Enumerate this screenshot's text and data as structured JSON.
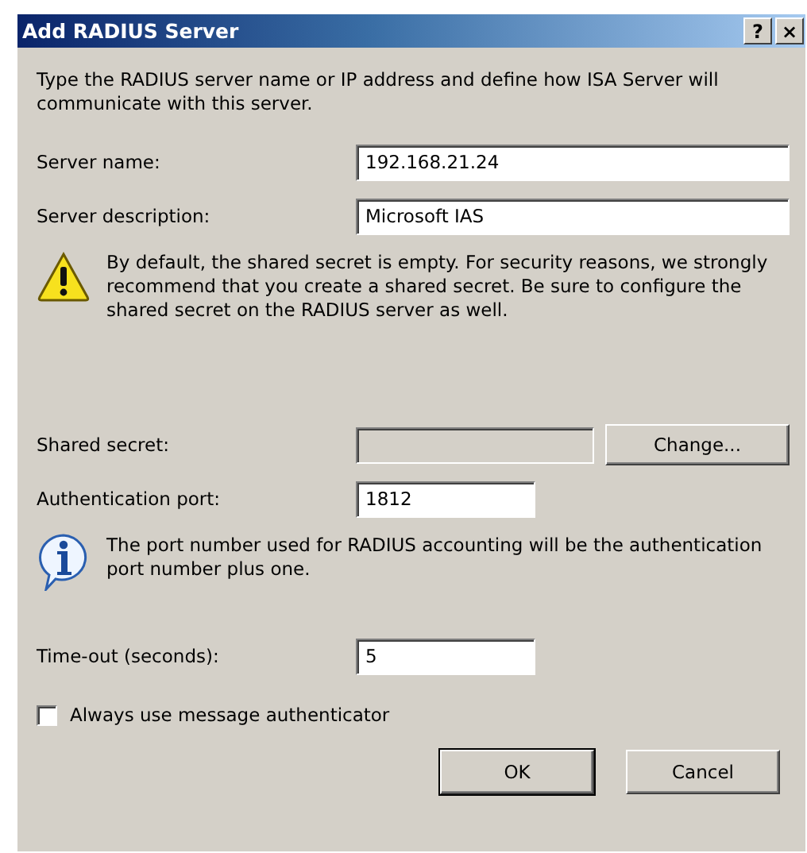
{
  "window": {
    "title": "Add RADIUS Server",
    "title_buttons": [
      "?",
      "×"
    ]
  },
  "intro": "Type the RADIUS server name or IP address and define how ISA Server will communicate with this server.",
  "fields_top": [
    {
      "label": "Server name:",
      "value": "192.168.21.24",
      "disabled": false
    },
    {
      "label": "Server description:",
      "value": "Microsoft IAS",
      "disabled": false
    }
  ],
  "warning": {
    "kind": "warning",
    "text": "By default, the shared secret is empty.  For security reasons, we strongly recommend that you create a shared secret.  Be sure to configure the shared secret on the RADIUS server as well."
  },
  "shared_secret": {
    "label": "Shared secret:",
    "disabled": true,
    "button": "Change..."
  },
  "auth_port": {
    "label": "Authentication port:",
    "value": "1812",
    "disabled": false
  },
  "info": {
    "kind": "info",
    "text": "The port number used for RADIUS accounting will be the authentication port number plus one."
  },
  "timeout": {
    "label": "Time-out (seconds):",
    "value": "5",
    "disabled": false
  },
  "checkbox": {
    "label": "Always use message authenticator",
    "checked": false
  },
  "buttons": [
    {
      "label": "OK",
      "default": true
    },
    {
      "label": "Cancel",
      "default": false
    }
  ]
}
